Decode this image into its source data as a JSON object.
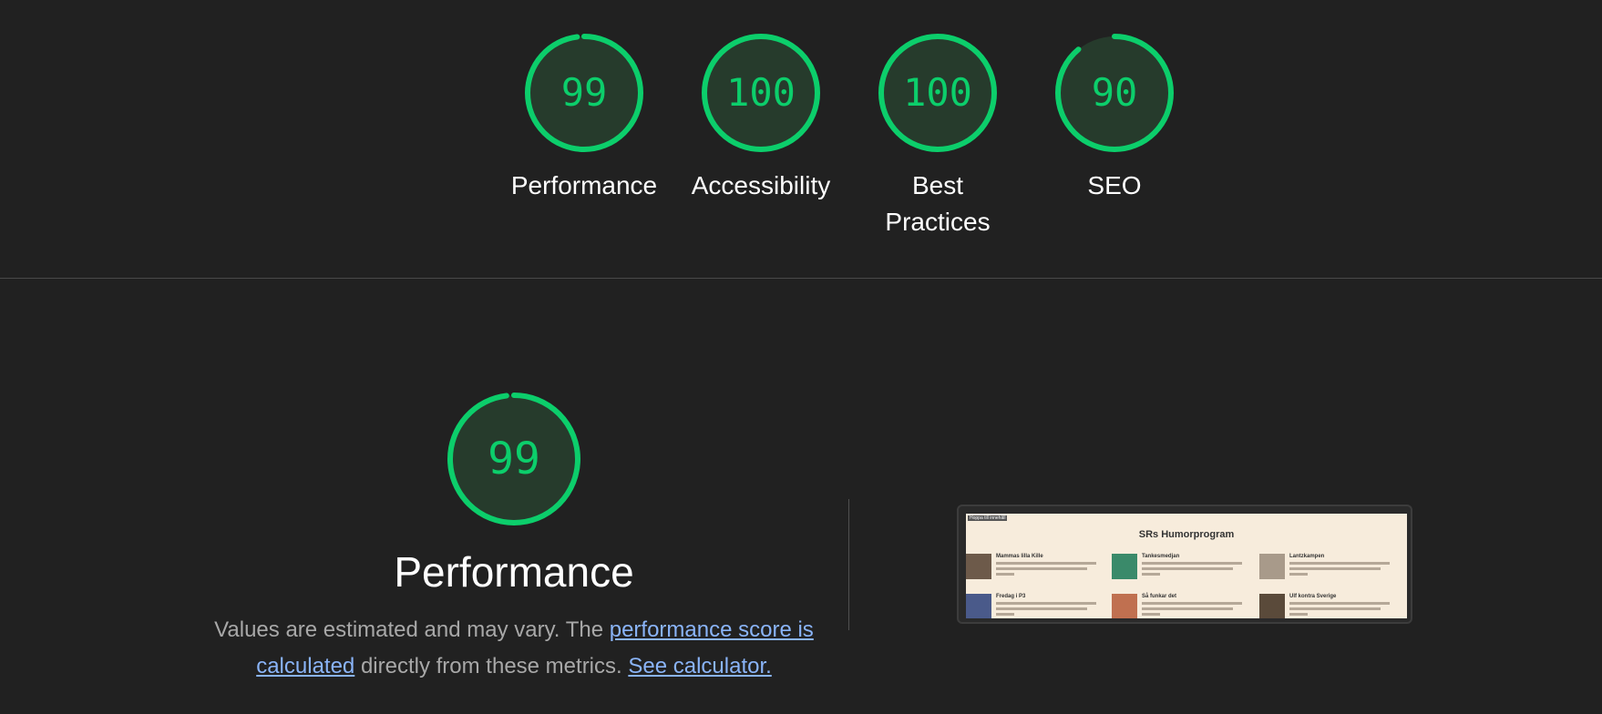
{
  "summary_gauges": [
    {
      "label": "Performance",
      "score": "99",
      "fraction": 0.99
    },
    {
      "label": "Accessibility",
      "score": "100",
      "fraction": 1.0
    },
    {
      "label": "Best Practices",
      "score": "100",
      "fraction": 1.0
    },
    {
      "label": "SEO",
      "score": "90",
      "fraction": 0.9
    }
  ],
  "performance": {
    "score": "99",
    "fraction": 0.99,
    "title": "Performance",
    "desc_prefix": "Values are estimated and may vary. The ",
    "link_score": "performance score is calculated",
    "desc_middle": " directly from these metrics. ",
    "link_calculator": "See calculator."
  },
  "screenshot": {
    "title": "SRs Humorprogram",
    "tag": "Hoppa till innehåll",
    "items": [
      {
        "name": "Mammas lilla Kille",
        "thumb": "#6d5a4a"
      },
      {
        "name": "Tankesmedjan",
        "thumb": "#3a8a6a"
      },
      {
        "name": "Lantzkampen",
        "thumb": "#a89a8a"
      },
      {
        "name": "Fredag i P3",
        "thumb": "#4a5a8a"
      },
      {
        "name": "Så funkar det",
        "thumb": "#c07050"
      },
      {
        "name": "Ulf kontra Sverige",
        "thumb": "#5a4a3a"
      }
    ]
  },
  "colors": {
    "background": "#212121",
    "gauge_green": "#0cce6b",
    "gauge_track": "#263b2c",
    "link": "#8ab4f8"
  }
}
